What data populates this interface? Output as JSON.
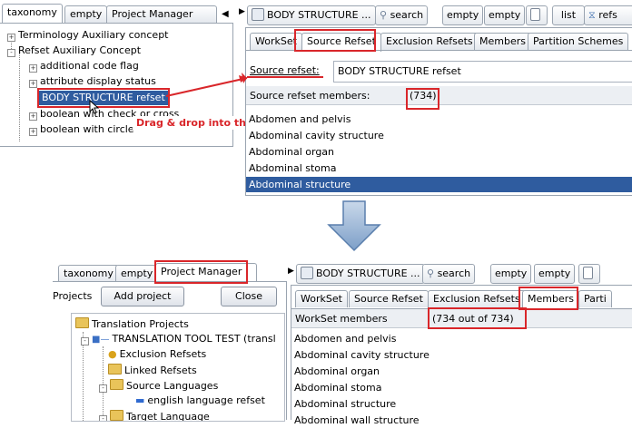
{
  "top": {
    "left_tabs": [
      "taxonomy",
      "empty",
      "Project Manager"
    ],
    "tree": [
      {
        "sign": "+",
        "label": "Terminology Auxiliary concept"
      },
      {
        "sign": "-",
        "label": "Refset Auxiliary Concept"
      },
      {
        "sign": "+",
        "label": "additional code flag"
      },
      {
        "sign": "+",
        "label": "attribute display status"
      },
      {
        "sign": "",
        "label": "BODY STRUCTURE refset"
      },
      {
        "sign": "+",
        "label": "boolean with check or cross"
      },
      {
        "sign": "+",
        "label": "boolean with circle"
      }
    ],
    "drag_hint": "Drag & drop into the right pane",
    "toolbar": [
      "BODY STRUCTURE ...",
      "search",
      "empty",
      "empty",
      "",
      "list",
      "refs"
    ],
    "right_tabs": [
      "WorkSet",
      "Source Refset",
      "Exclusion Refsets",
      "Members",
      "Partition Schemes"
    ],
    "source_refset_label": "Source refset:",
    "source_refset_value": "BODY STRUCTURE refset",
    "members_label": "Source refset members:",
    "members_count": "(734)",
    "members": [
      "Abdomen and pelvis",
      "Abdominal cavity structure",
      "Abdominal organ",
      "Abdominal stoma",
      "Abdominal structure"
    ]
  },
  "bottom": {
    "left_tabs": [
      "taxonomy",
      "empty",
      "Project Manager"
    ],
    "projects_label": "Projects",
    "add_project": "Add project",
    "close": "Close",
    "tree": [
      "Translation Projects",
      "TRANSLATION TOOL TEST (transl",
      "Exclusion Refsets",
      "Linked Refsets",
      "Source Languages",
      "english language refset",
      "Target Language"
    ],
    "toolbar": [
      "BODY STRUCTURE ...",
      "search",
      "empty",
      "empty",
      ""
    ],
    "right_tabs": [
      "WorkSet",
      "Source Refset",
      "Exclusion Refsets",
      "Members",
      "Parti"
    ],
    "workset_label": "WorkSet members",
    "workset_count": "(734 out of 734)",
    "members": [
      "Abdomen and pelvis",
      "Abdominal cavity structure",
      "Abdominal organ",
      "Abdominal stoma",
      "Abdominal structure",
      "Abdominal wall structure"
    ]
  },
  "colors": {
    "highlight": "#d9262a",
    "selection": "#2f5c9f",
    "arrow": "#8aa9cf"
  }
}
